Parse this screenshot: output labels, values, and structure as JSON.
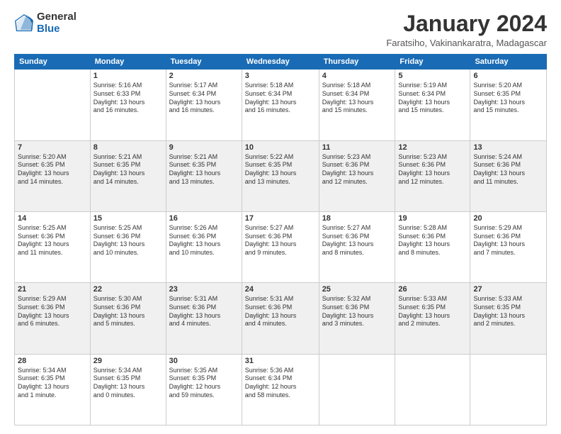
{
  "logo": {
    "general": "General",
    "blue": "Blue"
  },
  "header": {
    "title": "January 2024",
    "subtitle": "Faratsiho, Vakinankaratra, Madagascar"
  },
  "weekdays": [
    "Sunday",
    "Monday",
    "Tuesday",
    "Wednesday",
    "Thursday",
    "Friday",
    "Saturday"
  ],
  "weeks": [
    [
      {
        "day": "",
        "sunrise": "",
        "sunset": "",
        "daylight": ""
      },
      {
        "day": "1",
        "sunrise": "Sunrise: 5:16 AM",
        "sunset": "Sunset: 6:33 PM",
        "daylight": "Daylight: 13 hours and 16 minutes."
      },
      {
        "day": "2",
        "sunrise": "Sunrise: 5:17 AM",
        "sunset": "Sunset: 6:34 PM",
        "daylight": "Daylight: 13 hours and 16 minutes."
      },
      {
        "day": "3",
        "sunrise": "Sunrise: 5:18 AM",
        "sunset": "Sunset: 6:34 PM",
        "daylight": "Daylight: 13 hours and 16 minutes."
      },
      {
        "day": "4",
        "sunrise": "Sunrise: 5:18 AM",
        "sunset": "Sunset: 6:34 PM",
        "daylight": "Daylight: 13 hours and 15 minutes."
      },
      {
        "day": "5",
        "sunrise": "Sunrise: 5:19 AM",
        "sunset": "Sunset: 6:34 PM",
        "daylight": "Daylight: 13 hours and 15 minutes."
      },
      {
        "day": "6",
        "sunrise": "Sunrise: 5:20 AM",
        "sunset": "Sunset: 6:35 PM",
        "daylight": "Daylight: 13 hours and 15 minutes."
      }
    ],
    [
      {
        "day": "7",
        "sunrise": "Sunrise: 5:20 AM",
        "sunset": "Sunset: 6:35 PM",
        "daylight": "Daylight: 13 hours and 14 minutes."
      },
      {
        "day": "8",
        "sunrise": "Sunrise: 5:21 AM",
        "sunset": "Sunset: 6:35 PM",
        "daylight": "Daylight: 13 hours and 14 minutes."
      },
      {
        "day": "9",
        "sunrise": "Sunrise: 5:21 AM",
        "sunset": "Sunset: 6:35 PM",
        "daylight": "Daylight: 13 hours and 13 minutes."
      },
      {
        "day": "10",
        "sunrise": "Sunrise: 5:22 AM",
        "sunset": "Sunset: 6:35 PM",
        "daylight": "Daylight: 13 hours and 13 minutes."
      },
      {
        "day": "11",
        "sunrise": "Sunrise: 5:23 AM",
        "sunset": "Sunset: 6:36 PM",
        "daylight": "Daylight: 13 hours and 12 minutes."
      },
      {
        "day": "12",
        "sunrise": "Sunrise: 5:23 AM",
        "sunset": "Sunset: 6:36 PM",
        "daylight": "Daylight: 13 hours and 12 minutes."
      },
      {
        "day": "13",
        "sunrise": "Sunrise: 5:24 AM",
        "sunset": "Sunset: 6:36 PM",
        "daylight": "Daylight: 13 hours and 11 minutes."
      }
    ],
    [
      {
        "day": "14",
        "sunrise": "Sunrise: 5:25 AM",
        "sunset": "Sunset: 6:36 PM",
        "daylight": "Daylight: 13 hours and 11 minutes."
      },
      {
        "day": "15",
        "sunrise": "Sunrise: 5:25 AM",
        "sunset": "Sunset: 6:36 PM",
        "daylight": "Daylight: 13 hours and 10 minutes."
      },
      {
        "day": "16",
        "sunrise": "Sunrise: 5:26 AM",
        "sunset": "Sunset: 6:36 PM",
        "daylight": "Daylight: 13 hours and 10 minutes."
      },
      {
        "day": "17",
        "sunrise": "Sunrise: 5:27 AM",
        "sunset": "Sunset: 6:36 PM",
        "daylight": "Daylight: 13 hours and 9 minutes."
      },
      {
        "day": "18",
        "sunrise": "Sunrise: 5:27 AM",
        "sunset": "Sunset: 6:36 PM",
        "daylight": "Daylight: 13 hours and 8 minutes."
      },
      {
        "day": "19",
        "sunrise": "Sunrise: 5:28 AM",
        "sunset": "Sunset: 6:36 PM",
        "daylight": "Daylight: 13 hours and 8 minutes."
      },
      {
        "day": "20",
        "sunrise": "Sunrise: 5:29 AM",
        "sunset": "Sunset: 6:36 PM",
        "daylight": "Daylight: 13 hours and 7 minutes."
      }
    ],
    [
      {
        "day": "21",
        "sunrise": "Sunrise: 5:29 AM",
        "sunset": "Sunset: 6:36 PM",
        "daylight": "Daylight: 13 hours and 6 minutes."
      },
      {
        "day": "22",
        "sunrise": "Sunrise: 5:30 AM",
        "sunset": "Sunset: 6:36 PM",
        "daylight": "Daylight: 13 hours and 5 minutes."
      },
      {
        "day": "23",
        "sunrise": "Sunrise: 5:31 AM",
        "sunset": "Sunset: 6:36 PM",
        "daylight": "Daylight: 13 hours and 4 minutes."
      },
      {
        "day": "24",
        "sunrise": "Sunrise: 5:31 AM",
        "sunset": "Sunset: 6:36 PM",
        "daylight": "Daylight: 13 hours and 4 minutes."
      },
      {
        "day": "25",
        "sunrise": "Sunrise: 5:32 AM",
        "sunset": "Sunset: 6:36 PM",
        "daylight": "Daylight: 13 hours and 3 minutes."
      },
      {
        "day": "26",
        "sunrise": "Sunrise: 5:33 AM",
        "sunset": "Sunset: 6:35 PM",
        "daylight": "Daylight: 13 hours and 2 minutes."
      },
      {
        "day": "27",
        "sunrise": "Sunrise: 5:33 AM",
        "sunset": "Sunset: 6:35 PM",
        "daylight": "Daylight: 13 hours and 2 minutes."
      }
    ],
    [
      {
        "day": "28",
        "sunrise": "Sunrise: 5:34 AM",
        "sunset": "Sunset: 6:35 PM",
        "daylight": "Daylight: 13 hours and 1 minute."
      },
      {
        "day": "29",
        "sunrise": "Sunrise: 5:34 AM",
        "sunset": "Sunset: 6:35 PM",
        "daylight": "Daylight: 13 hours and 0 minutes."
      },
      {
        "day": "30",
        "sunrise": "Sunrise: 5:35 AM",
        "sunset": "Sunset: 6:35 PM",
        "daylight": "Daylight: 12 hours and 59 minutes."
      },
      {
        "day": "31",
        "sunrise": "Sunrise: 5:36 AM",
        "sunset": "Sunset: 6:34 PM",
        "daylight": "Daylight: 12 hours and 58 minutes."
      },
      {
        "day": "",
        "sunrise": "",
        "sunset": "",
        "daylight": ""
      },
      {
        "day": "",
        "sunrise": "",
        "sunset": "",
        "daylight": ""
      },
      {
        "day": "",
        "sunrise": "",
        "sunset": "",
        "daylight": ""
      }
    ]
  ]
}
